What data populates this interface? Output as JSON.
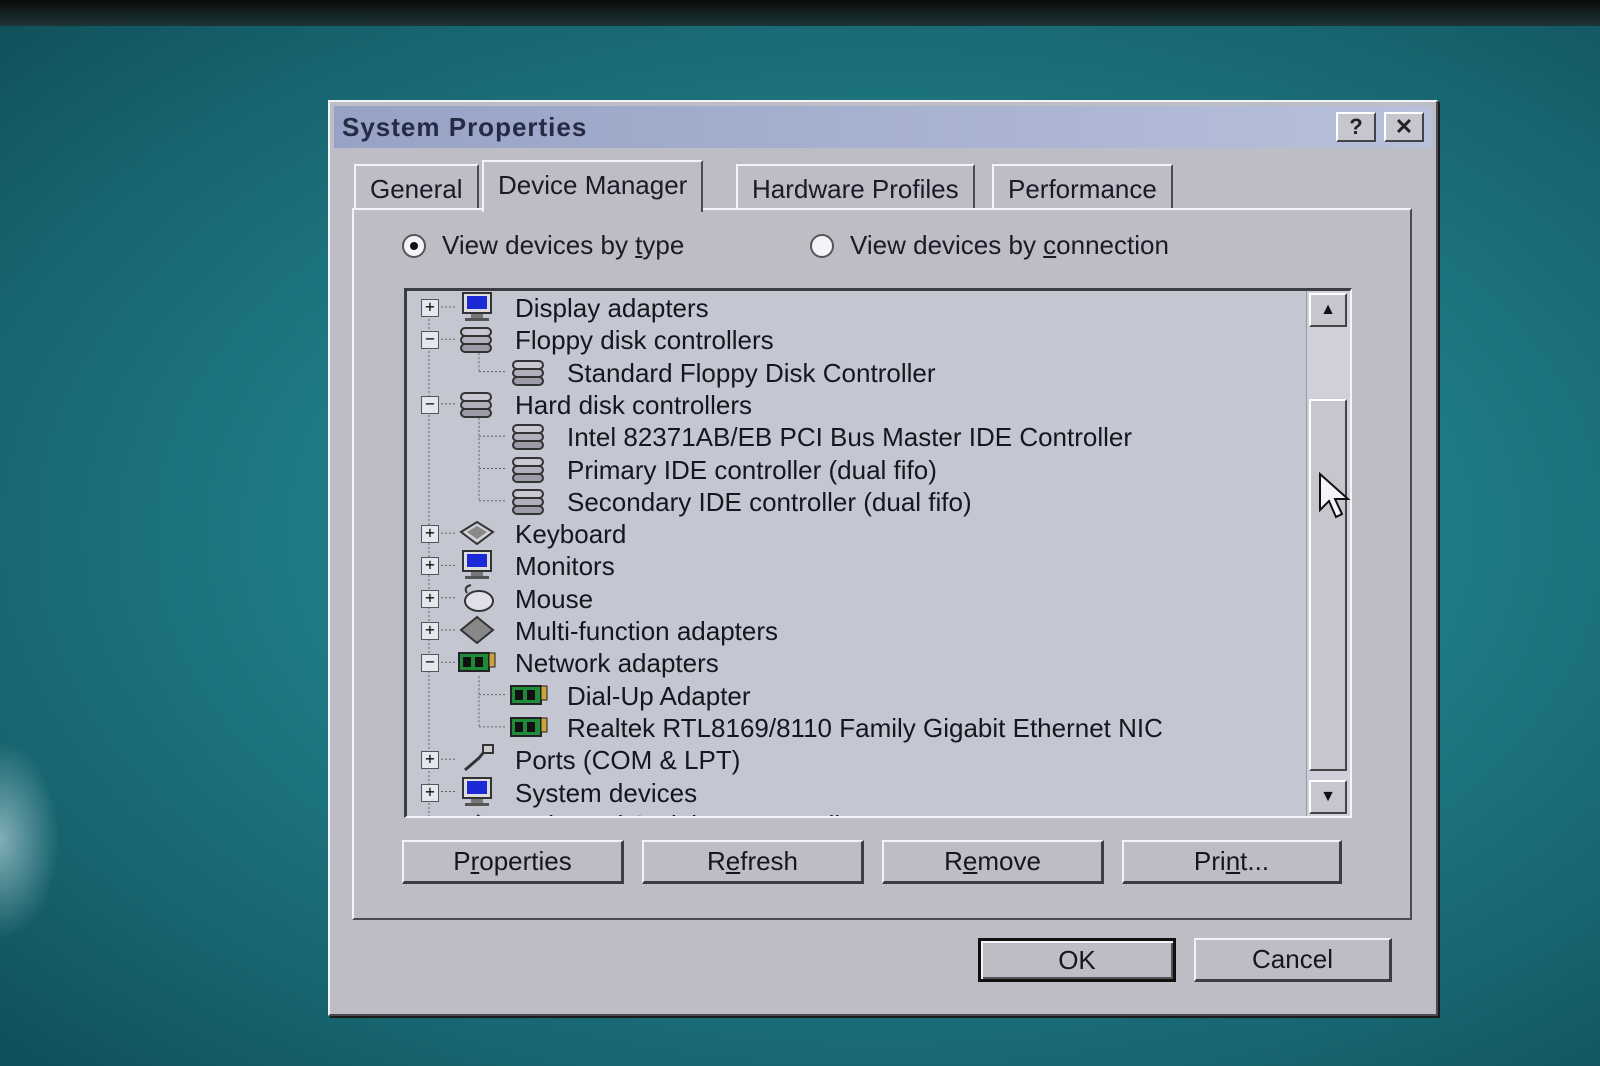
{
  "window": {
    "title": "System Properties",
    "help_label": "?",
    "close_label": "✕"
  },
  "tabs": [
    {
      "label": "General"
    },
    {
      "label": "Device Manager",
      "active": true
    },
    {
      "label": "Hardware Profiles"
    },
    {
      "label": "Performance"
    }
  ],
  "view_options": {
    "by_type": {
      "prefix": "View devices by ",
      "accel": "t",
      "suffix": "ype",
      "checked": true
    },
    "by_connection": {
      "prefix": "View devices by ",
      "accel": "c",
      "suffix": "onnection",
      "checked": false
    }
  },
  "device_tree": [
    {
      "label": "Display adapters",
      "level": 0,
      "expander": "+",
      "icon": "monitor-icon"
    },
    {
      "label": "Floppy disk controllers",
      "level": 0,
      "expander": "−",
      "icon": "disk-controller-icon"
    },
    {
      "label": "Standard Floppy Disk Controller",
      "level": 1,
      "icon": "disk-controller-icon"
    },
    {
      "label": "Hard disk controllers",
      "level": 0,
      "expander": "−",
      "icon": "disk-controller-icon"
    },
    {
      "label": "Intel 82371AB/EB PCI Bus Master IDE Controller",
      "level": 1,
      "icon": "disk-controller-icon"
    },
    {
      "label": "Primary IDE controller (dual fifo)",
      "level": 1,
      "icon": "disk-controller-icon"
    },
    {
      "label": "Secondary IDE controller (dual fifo)",
      "level": 1,
      "icon": "disk-controller-icon"
    },
    {
      "label": "Keyboard",
      "level": 0,
      "expander": "+",
      "icon": "keyboard-icon"
    },
    {
      "label": "Monitors",
      "level": 0,
      "expander": "+",
      "icon": "monitor-icon"
    },
    {
      "label": "Mouse",
      "level": 0,
      "expander": "+",
      "icon": "mouse-icon"
    },
    {
      "label": "Multi-function adapters",
      "level": 0,
      "expander": "+",
      "icon": "multifunction-icon"
    },
    {
      "label": "Network adapters",
      "level": 0,
      "expander": "−",
      "icon": "network-card-icon"
    },
    {
      "label": "Dial-Up Adapter",
      "level": 1,
      "icon": "network-card-icon"
    },
    {
      "label": "Realtek RTL8169/8110 Family Gigabit Ethernet NIC",
      "level": 1,
      "icon": "network-card-icon"
    },
    {
      "label": "Ports (COM & LPT)",
      "level": 0,
      "expander": "+",
      "icon": "port-icon"
    },
    {
      "label": "System devices",
      "level": 0,
      "expander": "+",
      "icon": "monitor-icon"
    },
    {
      "label": "Universal Serial Bus controllers",
      "level": 0,
      "expander": "+",
      "icon": "usb-icon"
    }
  ],
  "scrollbar": {
    "up_arrow": "▲",
    "down_arrow": "▼"
  },
  "panel_buttons": [
    {
      "prefix": "P",
      "accel": "r",
      "suffix": "operties"
    },
    {
      "prefix": "R",
      "accel": "e",
      "suffix": "fresh"
    },
    {
      "prefix": "R",
      "accel": "e",
      "suffix": "move"
    },
    {
      "prefix": "Pri",
      "accel": "n",
      "suffix": "t..."
    }
  ],
  "dialog_buttons": {
    "ok": "OK",
    "cancel": "Cancel"
  },
  "colors": {
    "face": "#bdbdc6",
    "titlebar": "#aab4d2",
    "desktop": "#1f7b86",
    "tree_bg": "#c4c6d2"
  }
}
